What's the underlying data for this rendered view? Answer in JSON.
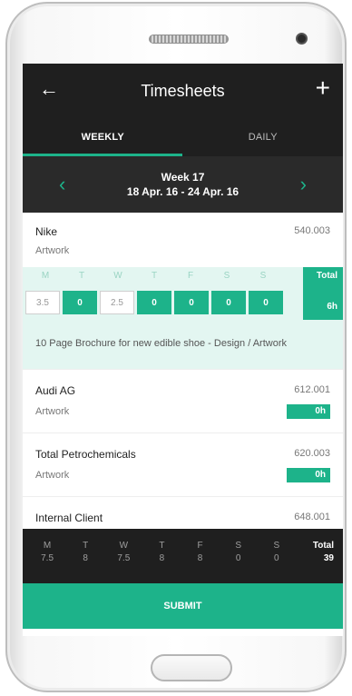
{
  "header": {
    "title": "Timesheets",
    "back_icon": "arrow-left-icon",
    "add_icon": "plus-icon"
  },
  "tabs": [
    {
      "label": "WEEKLY",
      "active": true
    },
    {
      "label": "DAILY",
      "active": false
    }
  ],
  "week": {
    "title": "Week 17",
    "range": "18 Apr. 16 - 24 Apr. 16"
  },
  "entries": [
    {
      "client": "Nike",
      "code": "540.003",
      "task": "Artwork",
      "days": [
        "M",
        "T",
        "W",
        "T",
        "F",
        "S",
        "S"
      ],
      "total_label": "Total",
      "values": [
        "3.5",
        "0",
        "2.5",
        "0",
        "0",
        "0",
        "0"
      ],
      "total": "6h",
      "description": "10 Page Brochure for new edible shoe - Design / Artwork"
    },
    {
      "client": "Audi AG",
      "code": "612.001",
      "task": "Artwork",
      "total": "0h"
    },
    {
      "client": "Total Petrochemicals",
      "code": "620.003",
      "task": "Artwork",
      "total": "0h"
    },
    {
      "client": "Internal Client",
      "code": "648.001"
    }
  ],
  "summary": {
    "days": [
      "M",
      "T",
      "W",
      "T",
      "F",
      "S",
      "S"
    ],
    "values": [
      "7.5",
      "8",
      "7.5",
      "8",
      "8",
      "0",
      "0"
    ],
    "total_label": "Total",
    "total": "39"
  },
  "submit_label": "SUBMIT",
  "colors": {
    "accent": "#1db38a",
    "dark": "#1f1f1f",
    "light_accent": "#e3f6f1"
  }
}
